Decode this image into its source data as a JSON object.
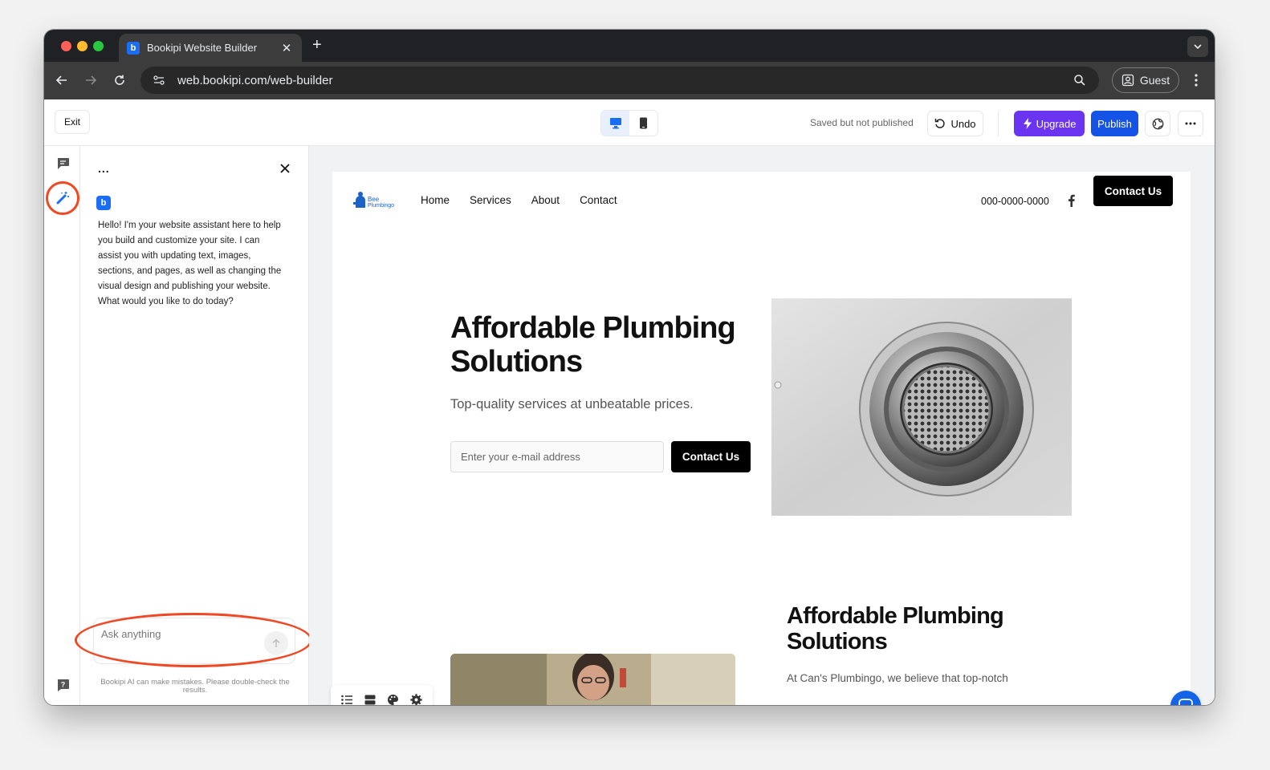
{
  "browser": {
    "tab_title": "Bookipi Website Builder",
    "favicon_letter": "b",
    "url": "web.bookipi.com/web-builder",
    "profile_label": "Guest"
  },
  "builder": {
    "exit_label": "Exit",
    "save_status": "Saved but not published",
    "undo_label": "Undo",
    "upgrade_label": "Upgrade",
    "publish_label": "Publish",
    "device_modes": [
      "desktop",
      "mobile"
    ],
    "active_device": "desktop"
  },
  "rail": {
    "items": [
      "chat-icon",
      "magic-wand-icon",
      "help-icon"
    ],
    "active": "magic-wand-icon",
    "highlight_color": "#ef4823"
  },
  "assistant": {
    "menu_label": "...",
    "avatar_letter": "b",
    "greeting": "Hello! I'm your website assistant here to help you build and customize your site. I can assist you with updating text, images, sections, and pages, as well as changing the visual design and publishing your website. What would you like to do today?",
    "input_placeholder": "Ask anything",
    "disclaimer": "Bookipi AI can make mistakes. Please double-check the results."
  },
  "site": {
    "logo_text_1": "Bee",
    "logo_text_2": "Plumbingo",
    "nav_links": [
      "Home",
      "Services",
      "About",
      "Contact"
    ],
    "phone": "000-0000-0000",
    "contact_button": "Contact Us",
    "hero": {
      "title": "Affordable Plumbing Solutions",
      "subtitle": "Top-quality services at unbeatable prices.",
      "email_placeholder": "Enter your e-mail address",
      "cta": "Contact Us"
    },
    "section2": {
      "title": "Affordable Plumbing Solutions",
      "text": "At Can's Plumbingo, we believe that top-notch"
    }
  },
  "colors": {
    "brand_blue": "#1b6ef3",
    "upgrade_purple": "#6b34f0",
    "publish_blue": "#1453e6",
    "annotation_red": "#ef4823"
  }
}
